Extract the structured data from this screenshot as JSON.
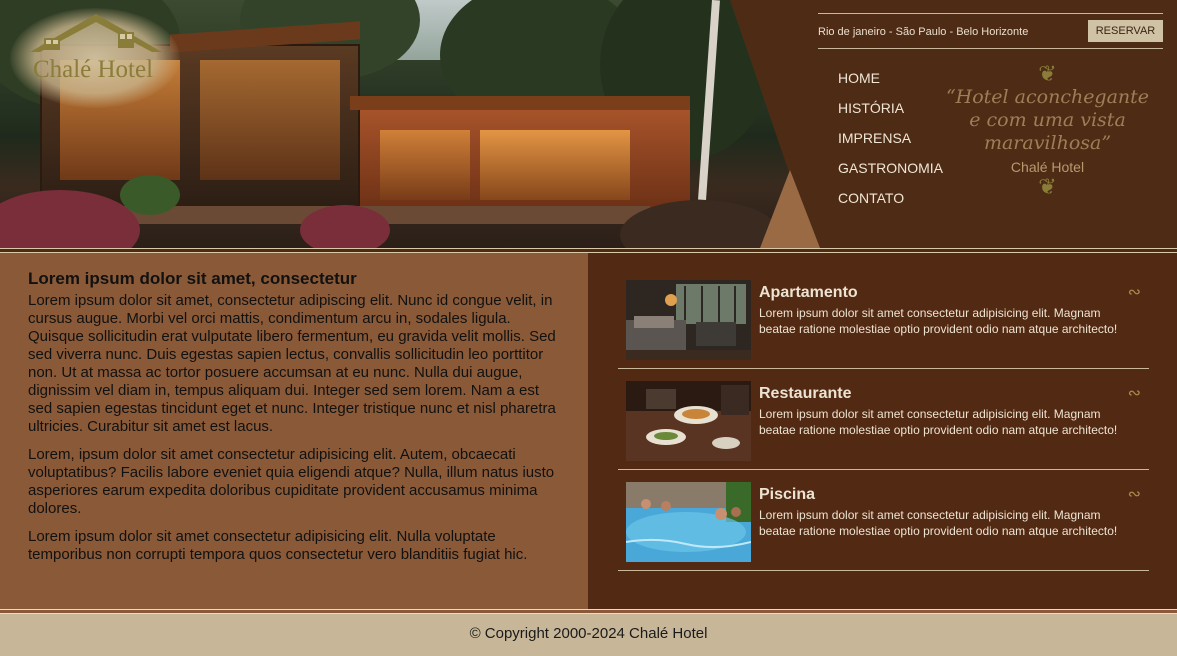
{
  "brand": {
    "logo_text": "Chalé Hotel"
  },
  "topbar": {
    "cities": "Rio de janeiro - São Paulo - Belo Horizonte",
    "reserve_label": "RESERVAR"
  },
  "nav": {
    "items": [
      "HOME",
      "HISTÓRIA",
      "IMPRENSA",
      "GASTRONOMIA",
      "CONTATO"
    ]
  },
  "quote": {
    "text": "“Hotel aconchegante e com uma vista maravilhosa”",
    "signature": "Chalé Hotel"
  },
  "main": {
    "heading": "Lorem ipsum dolor sit amet, consectetur",
    "paragraphs": [
      "Lorem ipsum dolor sit amet, consectetur adipiscing elit. Nunc id congue velit, in cursus augue. Morbi vel orci mattis, condimentum arcu in, sodales ligula. Quisque sollicitudin erat vulputate libero fermentum, eu gravida velit mollis. Sed sed viverra nunc. Duis egestas sapien lectus, convallis sollicitudin leo porttitor non. Ut at massa ac tortor posuere accumsan at eu nunc. Nulla dui augue, dignissim vel diam in, tempus aliquam dui. Integer sed sem lorem. Nam a est sed sapien egestas tincidunt eget et nunc. Integer tristique nunc et nisl pharetra ultricies. Curabitur sit amet est lacus.",
      "Lorem, ipsum dolor sit amet consectetur adipisicing elit. Autem, obcaecati voluptatibus? Facilis labore eveniet quia eligendi atque? Nulla, illum natus iusto asperiores earum expedita doloribus cupiditate provident accusamus minima dolores.",
      "Lorem ipsum dolor sit amet consectetur adipisicing elit. Nulla voluptate temporibus non corrupti tempora quos consectetur vero blanditiis fugiat hic."
    ]
  },
  "cards": [
    {
      "title": "Apartamento",
      "text": "Lorem ipsum dolor sit amet consectetur adipisicing elit. Magnam beatae ratione molestiae optio provident odio nam atque architecto!",
      "image_icon": "apartment-photo"
    },
    {
      "title": "Restaurante",
      "text": "Lorem ipsum dolor sit amet consectetur adipisicing elit. Magnam beatae ratione molestiae optio provident odio nam atque architecto!",
      "image_icon": "restaurant-photo"
    },
    {
      "title": "Piscina",
      "text": "Lorem ipsum dolor sit amet consectetur adipisicing elit. Magnam beatae ratione molestiae optio provident odio nam atque architecto!",
      "image_icon": "pool-photo"
    }
  ],
  "footer": {
    "copyright": "© Copyright 2000-2024 Chalé Hotel"
  },
  "colors": {
    "dark_brown": "#4e2b15",
    "mid_brown": "#8a5a38",
    "beige": "#c7b798",
    "gold": "#8a7d3a"
  }
}
